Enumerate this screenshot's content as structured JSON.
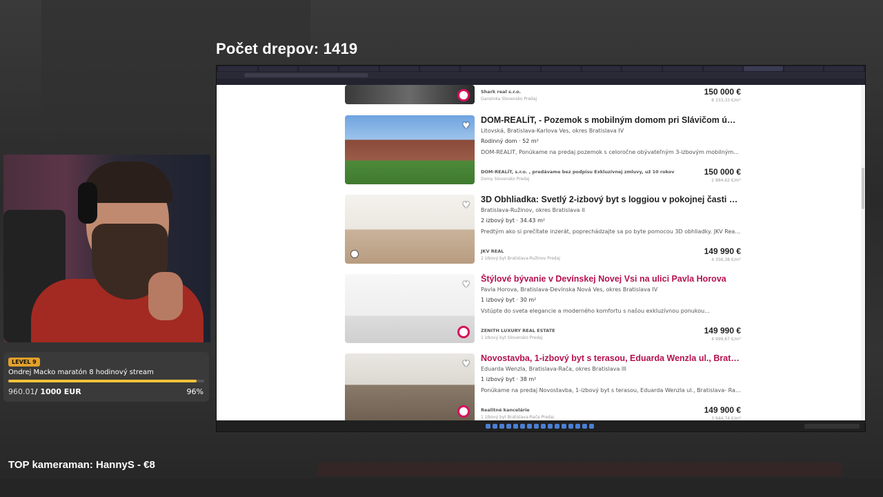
{
  "overlay": {
    "counter": "Počet drepov: 1419",
    "goal_level": "LEVEL 9",
    "goal_title": "Ondrej Macko maratón 8 hodinový stream",
    "goal_current": "960.01",
    "goal_target": "/ 1000 EUR",
    "goal_percent_label": "96%",
    "goal_progress": 0.96,
    "top_cameraman": "TOP kameraman: HannyS - €8"
  },
  "listings_partial": {
    "agency": "Shark real s.r.o.",
    "category": "Garsónka Slovensko Predaj",
    "price": "150 000 €",
    "price_per_m2": "8 333,33 €/m²"
  },
  "listings": [
    {
      "title": "DOM-REALÍT, - Pozemok s mobilným domom pri Slávičom údolí",
      "address": "Litovská, Bratislava-Karlova Ves, okres Bratislava IV",
      "type": "Rodinný dom · 52 m²",
      "desc": "DOM-REALÍT, Ponúkame na predaj pozemok s celoročne obývateľným 3-izbovým mobilným...",
      "agency": "DOM-REALÍT, s.r.o. , predávame bez podpisu Exkluzívnej zmluvy, už 10 rokov",
      "category": "Domy Slovensko Predaj",
      "price": "150 000 €",
      "price_per_m2": "2 884,62 €/m²"
    },
    {
      "title": "3D Obhliadka: Svetlý 2-izbový byt s loggiou v pokojnej časti Ru...",
      "address": "Bratislava-Ružinov, okres Bratislava II",
      "type": "2 izbový byt · 34.43 m²",
      "desc": "Predtým ako si prečítate inzerát, poprechádzajte sa po byte pomocou 3D obhliadky. JKV Real...",
      "agency": "JKV REAL",
      "category": "2 izbový byt Bratislava-Ružinov Predaj",
      "price": "149 990 €",
      "price_per_m2": "4 356,38 €/m²"
    },
    {
      "title": "Štýlové bývanie v Devínskej Novej Vsi na ulici Pavla Horova",
      "address": "Pavla Horova, Bratislava-Devínska Nová Ves, okres Bratislava IV",
      "type": "1 izbový byt · 30 m²",
      "desc": "Vstúpte do sveta elegancie a moderného komfortu s našou exkluzívnou ponukou...",
      "agency": "ZENITH LUXURY REAL ESTATE",
      "category": "1 izbový byt Slovensko Predaj",
      "price": "149 990 €",
      "price_per_m2": "4 999,67 €/m²"
    },
    {
      "title": "Novostavba, 1-izbový byt s terasou, Eduarda Wenzla ul., Bratisl...",
      "address": "Eduarda Wenzla, Bratislava-Rača, okres Bratislava III",
      "type": "1 izbový byt · 38 m²",
      "desc": "Ponúkame na predaj Novostavba, 1-izbový byt s terasou, Eduarda Wenzla ul., Bratislava- Rača...",
      "agency": "Realitné kancelárie",
      "category": "1 izbový byt Bratislava-Rača Predaj",
      "price": "149 900 €",
      "price_per_m2": "3 944,74 €/m²"
    }
  ],
  "icons": {
    "favorite": "heart-icon",
    "tour3d": "3d-tour-icon",
    "agency_badge": "agency-logo-icon"
  },
  "colors": {
    "highlight_title": "#b4114f",
    "goal_bar": "#f1c13a",
    "level_badge": "#e3a02a"
  }
}
